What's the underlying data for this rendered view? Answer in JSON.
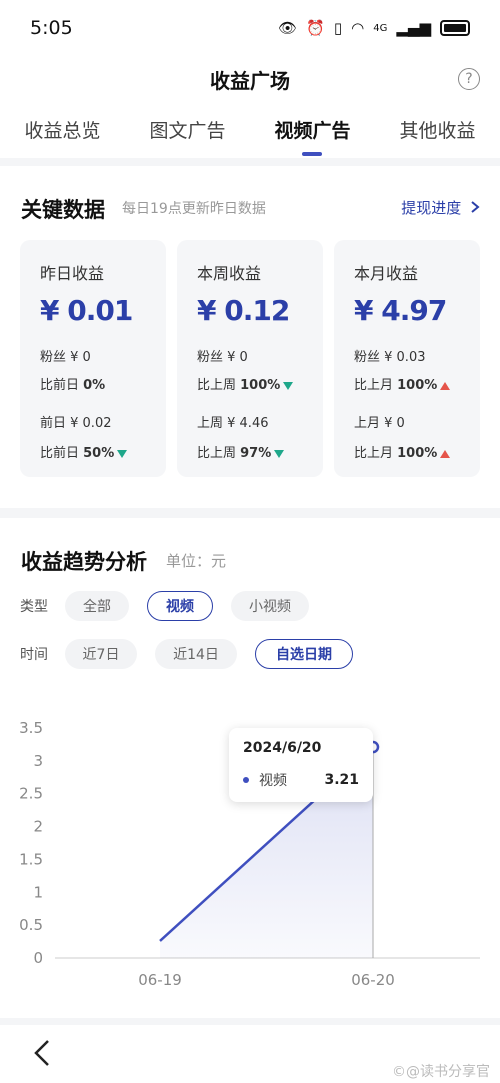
{
  "status": {
    "time": "5:05",
    "network": "4G"
  },
  "header": {
    "title": "收益广场",
    "help": "?"
  },
  "tabs": [
    {
      "label": "收益总览",
      "active": false
    },
    {
      "label": "图文广告",
      "active": false
    },
    {
      "label": "视频广告",
      "active": true
    },
    {
      "label": "其他收益",
      "active": false
    }
  ],
  "key": {
    "title": "关键数据",
    "subtitle": "每日19点更新昨日数据",
    "withdraw": "提现进度",
    "cards": [
      {
        "label": "昨日收益",
        "amount": "¥ 0.01",
        "fans": "粉丝 ¥ 0",
        "cmp1_prefix": "比前日 ",
        "cmp1_value": "0%",
        "prev": "前日 ¥ 0.02",
        "cmp2_prefix": "比前日 ",
        "cmp2_value": "50%"
      },
      {
        "label": "本周收益",
        "amount": "¥ 0.12",
        "fans": "粉丝 ¥ 0",
        "cmp1_prefix": "比上周 ",
        "cmp1_value": "100%",
        "prev": "上周 ¥ 4.46",
        "cmp2_prefix": "比上周 ",
        "cmp2_value": "97%"
      },
      {
        "label": "本月收益",
        "amount": "¥ 4.97",
        "fans": "粉丝 ¥ 0.03",
        "cmp1_prefix": "比上月 ",
        "cmp1_value": "100%",
        "prev": "上月 ¥ 0",
        "cmp2_prefix": "比上月 ",
        "cmp2_value": "100%"
      }
    ]
  },
  "trend": {
    "title": "收益趋势分析",
    "unit": "单位：元",
    "type_label": "类型",
    "type_options": [
      {
        "label": "全部",
        "selected": false
      },
      {
        "label": "视频",
        "selected": true
      },
      {
        "label": "小视频",
        "selected": false
      }
    ],
    "time_label": "时间",
    "time_options": [
      {
        "label": "近7日",
        "selected": false
      },
      {
        "label": "近14日",
        "selected": false
      },
      {
        "label": "自选日期",
        "selected": true
      }
    ],
    "tooltip": {
      "date": "2024/6/20",
      "series": "视频",
      "value": "3.21"
    }
  },
  "colors": {
    "accent": "#2b3fa8",
    "down": "#1ea78a",
    "up": "#e5544a",
    "line": "#3f4fbf"
  },
  "chart_data": {
    "type": "area",
    "categories": [
      "06-19",
      "06-20"
    ],
    "series": [
      {
        "name": "视频",
        "values": [
          0.26,
          3.21
        ]
      }
    ],
    "ylim": [
      0,
      3.5
    ],
    "yticks": [
      "0",
      "0.5",
      "1",
      "1.5",
      "2",
      "2.5",
      "3",
      "3.5"
    ],
    "grid": false
  },
  "nav": {
    "watermark": "©@读书分享官"
  }
}
